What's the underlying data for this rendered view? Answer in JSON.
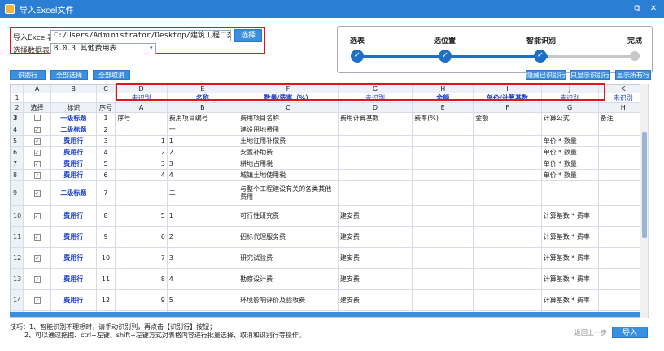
{
  "window": {
    "title": "导入Excel文件"
  },
  "file": {
    "import_label": "导入Excel表",
    "path": "C:/Users/Administrator/Desktop/建筑工程二类费模板.xls",
    "choose_button": "选择",
    "sheet_label": "选择数据表",
    "sheet_value": "B.0.3 其他费用表"
  },
  "steps": [
    {
      "label": "选表",
      "done": true
    },
    {
      "label": "选位置",
      "done": true
    },
    {
      "label": "智能识别",
      "done": true
    },
    {
      "label": "完成",
      "done": false
    }
  ],
  "toolbar": {
    "identify": "识别行",
    "select_all": "全部选择",
    "deselect_all": "全部取消",
    "hide_identified": "隐藏已识别行",
    "show_identified_only": "只显示识别行",
    "show_all": "显示所有行"
  },
  "grid": {
    "col_letters": [
      "",
      "A",
      "B",
      "C",
      "D",
      "E",
      "F",
      "G",
      "H",
      "I",
      "J",
      "K"
    ],
    "row1_labels": [
      "1",
      "",
      "",
      "",
      "未识别",
      "名称",
      "数量/费率（%）",
      "未识别",
      "金额",
      "单价/计算基数",
      "未识别",
      "未识别"
    ],
    "row2": [
      "2",
      "选择",
      "标识",
      "序号",
      "A",
      "B",
      "C",
      "D",
      "E",
      "F",
      "G",
      "H"
    ],
    "rows": [
      {
        "n": "3",
        "checked": false,
        "tag": "一级标题",
        "seq": "1",
        "a": "序号",
        "b": "费用项目编号",
        "c": "费用项目名称",
        "d": "费用计算基数",
        "e": "费率(%)",
        "f": "金额",
        "g": "计算公式",
        "h": "备注"
      },
      {
        "n": "4",
        "checked": true,
        "tag": "二级标题",
        "seq": "2",
        "a": "",
        "b": "一",
        "c": "建设用地费用",
        "d": "",
        "e": "",
        "f": "",
        "g": "",
        "h": ""
      },
      {
        "n": "5",
        "checked": true,
        "tag": "费用行",
        "seq": "3",
        "a": "1",
        "b": "1",
        "c": "土地征用补偿费",
        "d": "",
        "e": "",
        "f": "",
        "g": "单价 * 数量",
        "h": ""
      },
      {
        "n": "6",
        "checked": true,
        "tag": "费用行",
        "seq": "4",
        "a": "2",
        "b": "2",
        "c": "安置补助费",
        "d": "",
        "e": "",
        "f": "",
        "g": "单价 * 数量",
        "h": ""
      },
      {
        "n": "7",
        "checked": true,
        "tag": "费用行",
        "seq": "5",
        "a": "3",
        "b": "3",
        "c": "耕地占用税",
        "d": "",
        "e": "",
        "f": "",
        "g": "单价 * 数量",
        "h": ""
      },
      {
        "n": "8",
        "checked": true,
        "tag": "费用行",
        "seq": "6",
        "a": "4",
        "b": "4",
        "c": "城镇土地使用税",
        "d": "",
        "e": "",
        "f": "",
        "g": "单价 * 数量",
        "h": ""
      },
      {
        "n": "9",
        "checked": true,
        "tag": "二级标题",
        "seq": "7",
        "a": "",
        "b": "二",
        "c": "与整个工程建设有关的各类其他费用",
        "d": "",
        "e": "",
        "f": "",
        "g": "",
        "h": ""
      },
      {
        "n": "10",
        "checked": true,
        "tag": "费用行",
        "seq": "8",
        "a": "5",
        "b": "1",
        "c": "可行性研究费",
        "d": "建安费",
        "e": "",
        "f": "",
        "g": "计算基数 * 费率",
        "h": ""
      },
      {
        "n": "11",
        "checked": true,
        "tag": "费用行",
        "seq": "9",
        "a": "6",
        "b": "2",
        "c": "招标代理服务费",
        "d": "建安费",
        "e": "",
        "f": "",
        "g": "计算基数 * 费率",
        "h": ""
      },
      {
        "n": "12",
        "checked": true,
        "tag": "费用行",
        "seq": "10",
        "a": "7",
        "b": "3",
        "c": "研究试验费",
        "d": "建安费",
        "e": "",
        "f": "",
        "g": "计算基数 * 费率",
        "h": ""
      },
      {
        "n": "13",
        "checked": true,
        "tag": "费用行",
        "seq": "11",
        "a": "8",
        "b": "4",
        "c": "勘察设计费",
        "d": "建安费",
        "e": "",
        "f": "",
        "g": "计算基数 * 费率",
        "h": ""
      },
      {
        "n": "14",
        "checked": true,
        "tag": "费用行",
        "seq": "12",
        "a": "9",
        "b": "5",
        "c": "环境影响评价及验收费",
        "d": "建安费",
        "e": "",
        "f": "",
        "g": "计算基数 * 费率",
        "h": ""
      },
      {
        "n": "15",
        "checked": true,
        "tag": "费用行",
        "seq": "13",
        "a": "10",
        "b": "6",
        "c": "工程监理费",
        "d": "建安费",
        "e": "",
        "f": "",
        "g": "计算基数 * 费率",
        "h": ""
      }
    ]
  },
  "tips": {
    "line1": "技巧：1、智能识别不理想时，请手动识别列，再点击【识别行】按钮；",
    "line2": "2、可以通过拖拽、ctrl+左键、shift+左键方式对表格内容进行批量选择、取消和识别行等操作。"
  },
  "footer": {
    "import_button": "导入",
    "ghost_text": "返回上一步"
  }
}
